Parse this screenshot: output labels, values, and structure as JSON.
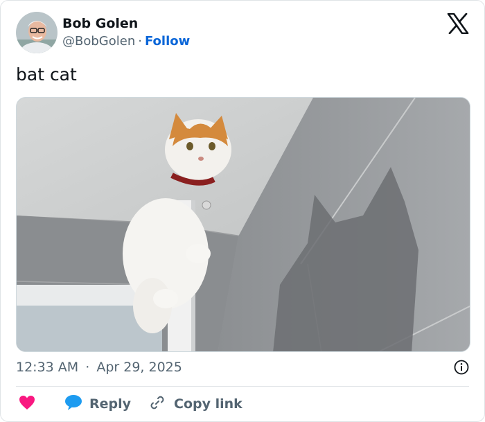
{
  "author": {
    "name": "Bob Golen",
    "handle": "@BobGolen",
    "separator": "·",
    "follow_label": "Follow"
  },
  "tweet": {
    "text": "bat cat",
    "time": "12:33 AM",
    "separator": "·",
    "date": "Apr 29, 2025"
  },
  "actions": {
    "reply_label": "Reply",
    "copy_link_label": "Copy link"
  },
  "colors": {
    "follow": "#0a66d8",
    "heart": "#f91880",
    "reply_bubble": "#1d9bf0",
    "muted_text": "#536471"
  },
  "icons": [
    "x-logo-icon",
    "info-icon",
    "heart-icon",
    "reply-bubble-icon",
    "link-icon"
  ]
}
